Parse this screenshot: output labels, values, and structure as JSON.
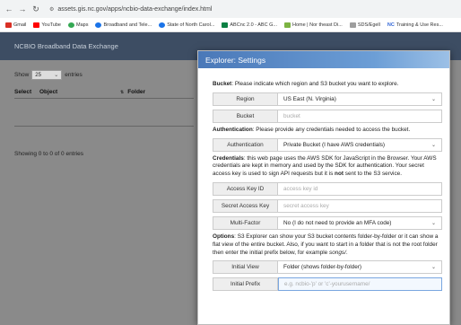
{
  "browser": {
    "url": "assets.gis.nc.gov/apps/ncbio-data-exchange/index.html",
    "bookmarks": [
      {
        "label": "Gmail",
        "color": "#d93025"
      },
      {
        "label": "YouTube",
        "color": "#ff0000"
      },
      {
        "label": "Maps",
        "color": "#34a853"
      },
      {
        "label": "Broadband and Tele...",
        "color": "#1a73e8"
      },
      {
        "label": "State of North Carol...",
        "color": "#1a73e8"
      },
      {
        "label": "ABCnc 2.0 - ABC G...",
        "color": "#0b8043"
      },
      {
        "label": "Home | Nor theast Di...",
        "color": "#7cb342"
      },
      {
        "label": "SDS/Egell",
        "color": "#9e9e9e"
      },
      {
        "label": "Training & Use Res...",
        "color": "#3367d6"
      }
    ],
    "bookmark_nc_prefix": "NC"
  },
  "page": {
    "title": "NCBIO Broadband Data Exchange",
    "show_label": "Show",
    "show_value": "25",
    "entries_label": "entries",
    "columns": [
      "Select",
      "Object",
      "Folder"
    ],
    "showing_text": "Showing 0 to 0 of 0 entries"
  },
  "modal": {
    "title": "Explorer: Settings",
    "bucket_heading": "Bucket",
    "bucket_text": ": Please indicate which region and S3 bucket you want to explore.",
    "region_label": "Region",
    "region_value": "US East (N. Virginia)",
    "bucket_label": "Bucket",
    "bucket_placeholder": "bucket",
    "auth_heading": "Authentication",
    "auth_text": ": Please provide any credentials needed to access the bucket.",
    "authentication_label": "Authentication",
    "authentication_value": "Private Bucket (I have AWS credentials)",
    "cred_heading": "Credentials",
    "cred_text_1": ": this web page uses the AWS SDK for JavaScript in the Browser. Your AWS credentials are kept in memory and used by the SDK for authentication. Your secret access key is used to sign API requests but it is ",
    "cred_not": "not",
    "cred_text_2": " sent to the S3 service.",
    "access_key_label": "Access Key ID",
    "access_key_placeholder": "access key id",
    "secret_key_label": "Secret Access Key",
    "secret_key_placeholder": "secret access key",
    "mfa_label": "Multi-Factor",
    "mfa_value": "No (I do not need to provide an MFA code)",
    "options_heading": "Options",
    "options_text_1": ": S3 Explorer can show your S3 bucket contents folder-by-folder or it can show a flat view of the entire bucket. Also, if you want to start in a folder that is not the root folder then enter the initial prefix below, for example ",
    "options_example": "songs/",
    "options_text_2": ".",
    "initial_view_label": "Initial View",
    "initial_view_value": "Folder (shows folder-by-folder)",
    "initial_prefix_label": "Initial Prefix",
    "initial_prefix_placeholder": "e.g. ncbio-'p' or 'c'-yourusername/"
  }
}
